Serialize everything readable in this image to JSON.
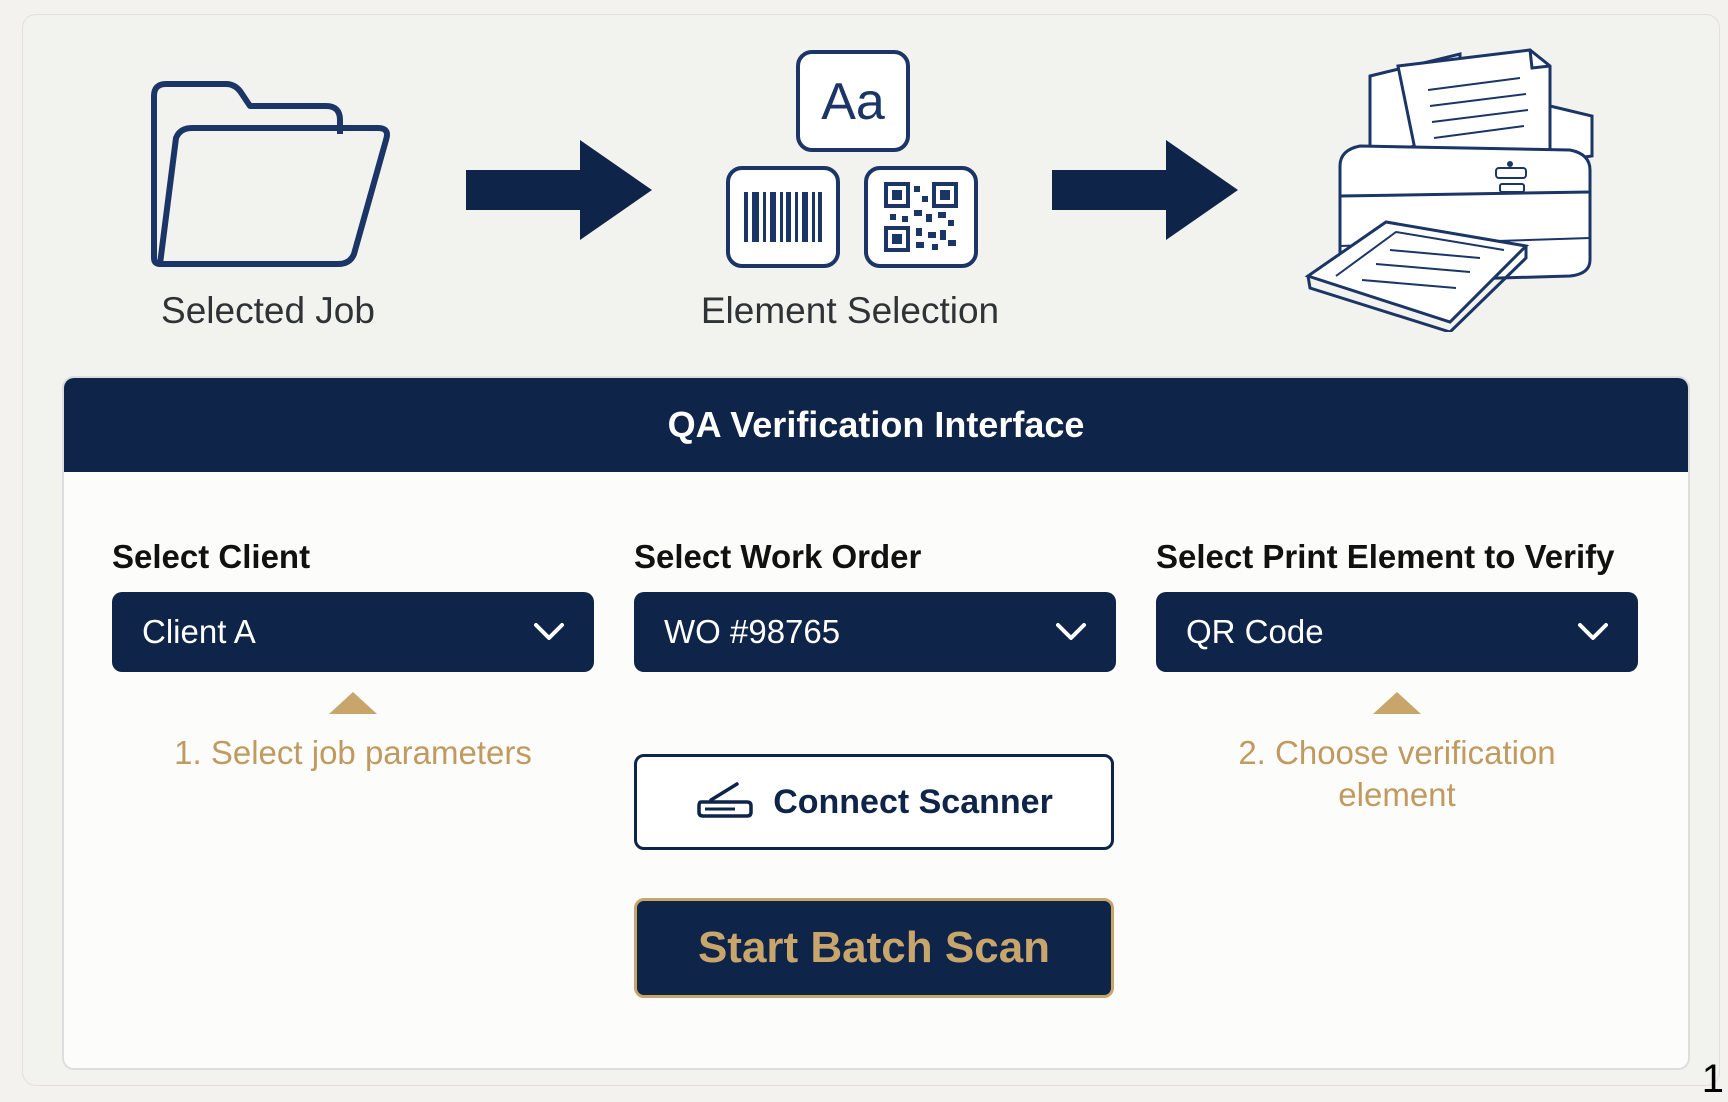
{
  "workflow": {
    "steps": [
      {
        "label": "Selected Job",
        "icon": "folder-icon"
      },
      {
        "label": "Element Selection",
        "icon": "element-selection-icon",
        "badge_text": "Aa"
      },
      {
        "label": "",
        "icon": "scanner-printer-icon"
      }
    ]
  },
  "panel": {
    "title": "QA Verification Interface",
    "fields": [
      {
        "label": "Select Client",
        "value": "Client A"
      },
      {
        "label": "Select Work Order",
        "value": "WO #98765"
      },
      {
        "label": "Select Print Element to Verify",
        "value": "QR Code"
      }
    ],
    "hints": {
      "job_parameters": "1. Select job parameters",
      "verification_element": "2. Choose verification element"
    },
    "buttons": {
      "connect_scanner": "Connect Scanner",
      "start_batch_scan": "Start Batch Scan"
    }
  },
  "page_number": "1",
  "colors": {
    "navy": "#0e2448",
    "gold": "#c8a56b",
    "background": "#f2f2ee"
  }
}
